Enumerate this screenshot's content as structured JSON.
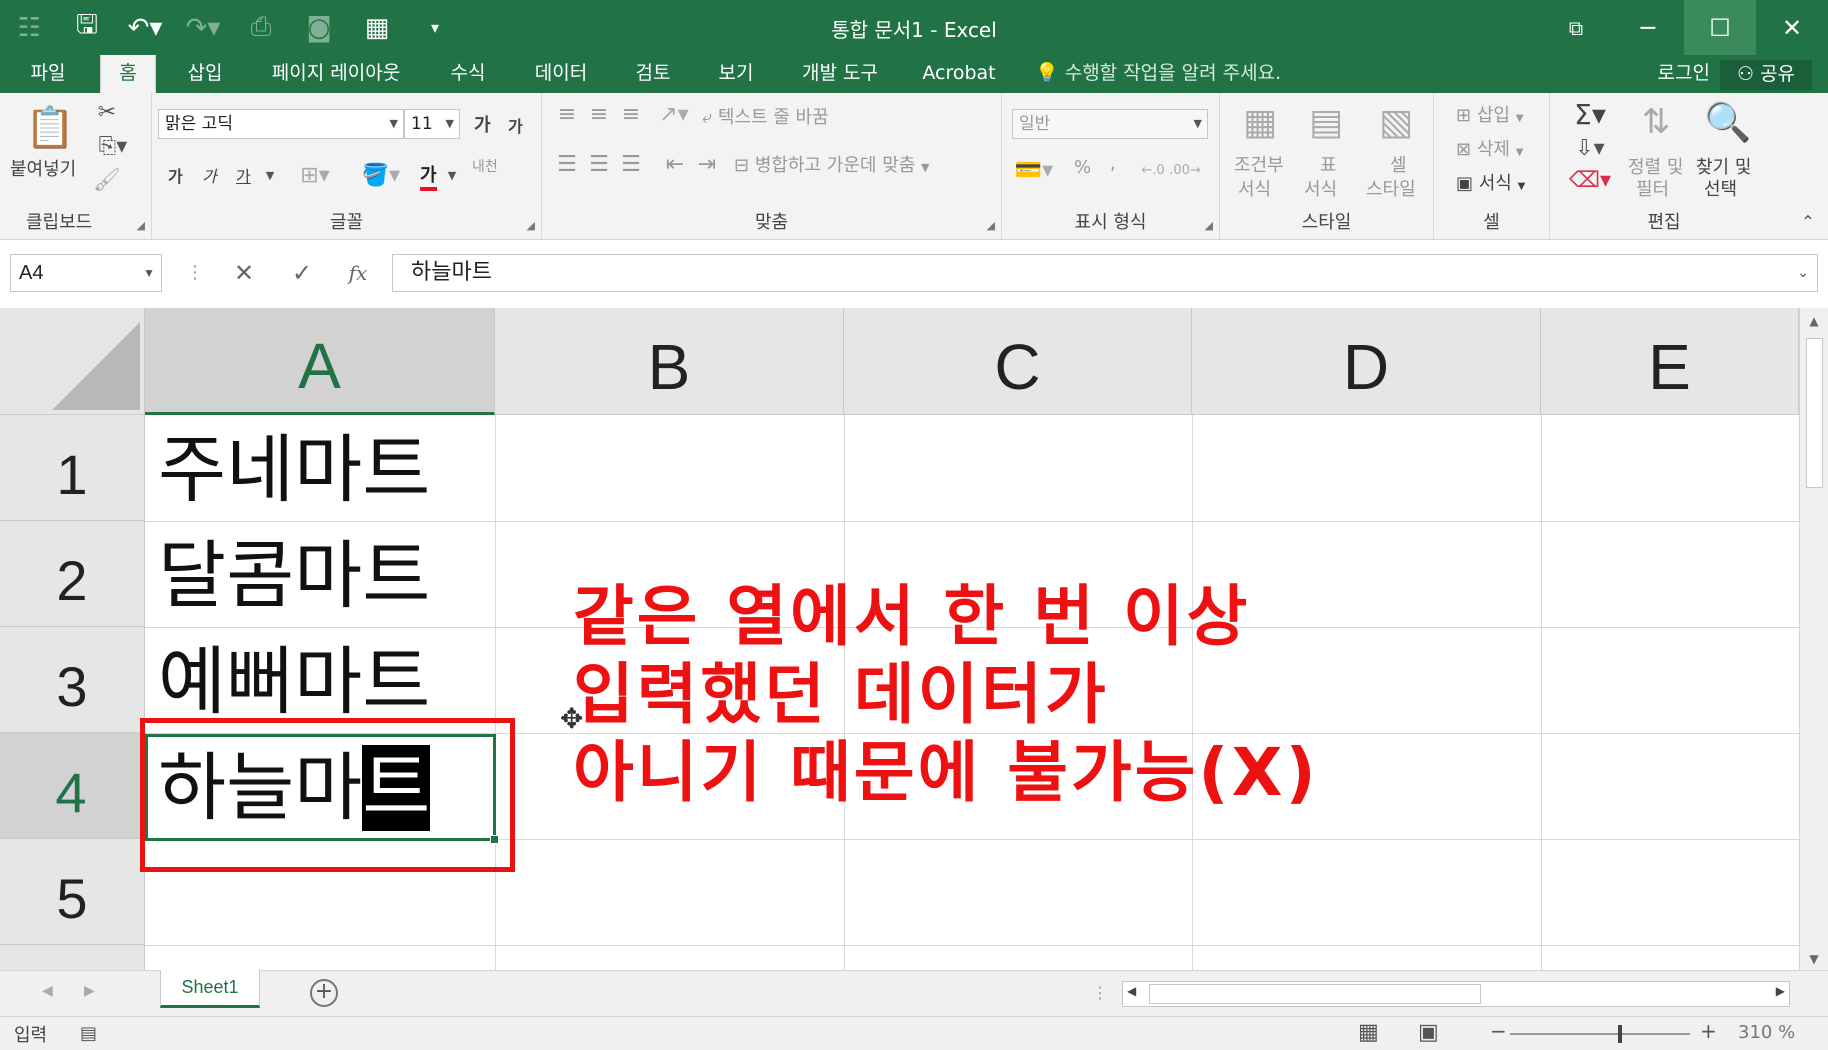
{
  "window": {
    "title": "통합 문서1 - Excel",
    "qat_icons": [
      "grid-icon",
      "save-icon",
      "undo-icon",
      "redo-icon",
      "print-preview-icon",
      "camera-icon",
      "form-icon",
      "customize-icon"
    ]
  },
  "tabs": {
    "items": [
      "파일",
      "홈",
      "삽입",
      "페이지 레이아웃",
      "수식",
      "데이터",
      "검토",
      "보기",
      "개발 도구",
      "Acrobat"
    ],
    "active": "홈",
    "tell_me": "수행할 작업을 알려 주세요.",
    "login": "로그인",
    "share": "공유"
  },
  "ribbon": {
    "clipboard": {
      "paste": "붙여넣기",
      "label": "클립보드"
    },
    "font": {
      "name": "맑은 고딕",
      "size": "11",
      "grow": "가",
      "shrink": "가",
      "bold": "가",
      "italic": "가",
      "underline": "가",
      "color_letter": "가",
      "phonetic": "내천",
      "label": "글꼴"
    },
    "alignment": {
      "wrap": "텍스트 줄 바꿈",
      "merge": "병합하고 가운데 맞춤",
      "label": "맞춤"
    },
    "number": {
      "format": "일반",
      "percent": "%",
      "comma": ",",
      "label": "표시 형식"
    },
    "styles": {
      "conditional": [
        "조건부",
        "서식"
      ],
      "table": [
        "표",
        "서식"
      ],
      "cell": [
        "셀",
        "스타일"
      ],
      "label": "스타일"
    },
    "cells": {
      "insert": "삽입",
      "delete": "삭제",
      "format": "서식",
      "label": "셀"
    },
    "editing": {
      "sort": [
        "정렬 및",
        "필터"
      ],
      "find": [
        "찾기 및",
        "선택"
      ],
      "label": "편집"
    }
  },
  "formula_bar": {
    "name_box": "A4",
    "value": "하늘마트"
  },
  "sheet": {
    "columns": [
      "A",
      "B",
      "C",
      "D",
      "E"
    ],
    "selected_column": "A",
    "rows": [
      "1",
      "2",
      "3",
      "4",
      "5"
    ],
    "selected_row": "4",
    "cells": [
      {
        "ref": "A1",
        "value": "주네마트"
      },
      {
        "ref": "A2",
        "value": "달콤마트"
      },
      {
        "ref": "A3",
        "value": "예뻐마트"
      },
      {
        "ref": "A4",
        "value_before": "하늘마",
        "value_caret": "트"
      }
    ],
    "annotation": [
      "같은 열에서 한 번 이상",
      "입력했던 데이터가",
      "아니기 때문에 불가능(X)"
    ],
    "annotation_color": "#ee1111"
  },
  "sheet_tabs": {
    "items": [
      "Sheet1"
    ],
    "active": "Sheet1"
  },
  "status": {
    "mode": "입력",
    "zoom": "310 %"
  },
  "colors": {
    "excel_green": "#217346",
    "ribbon_bg": "#f3f3f3"
  }
}
